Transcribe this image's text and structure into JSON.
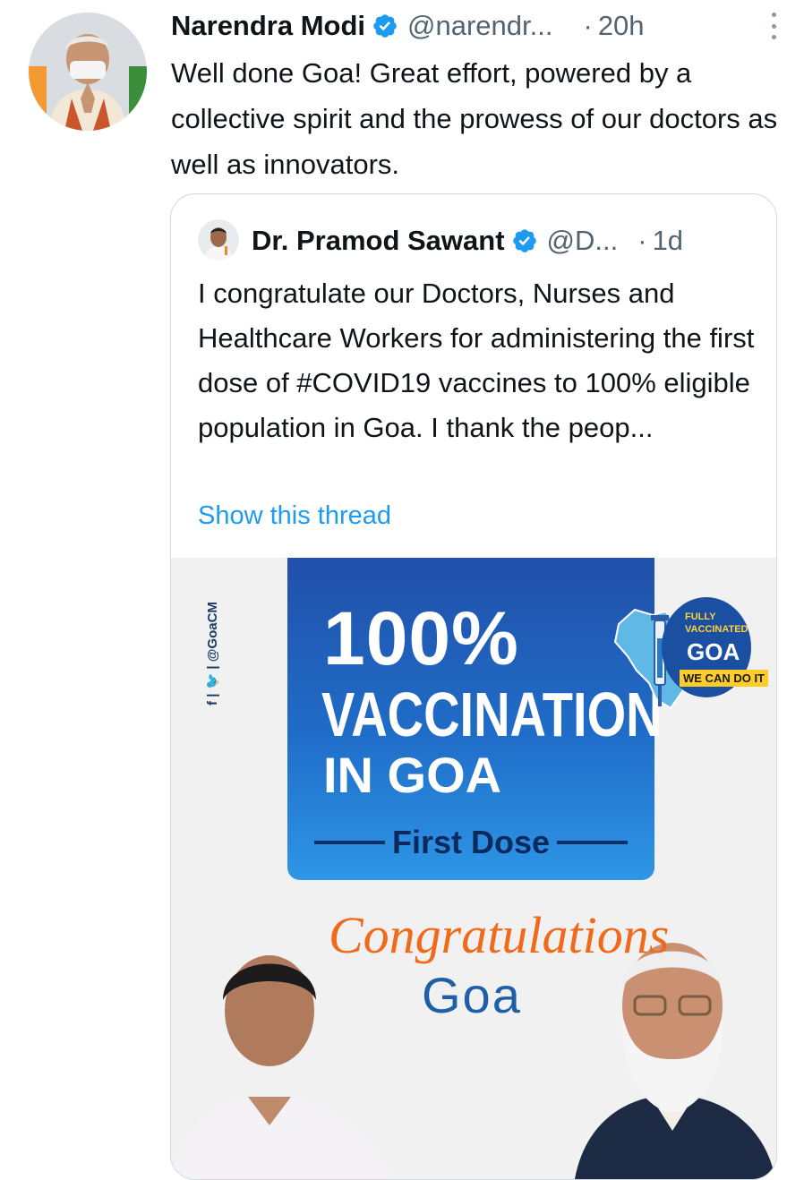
{
  "tweet": {
    "author_name": "Narendra Modi",
    "handle": "@narendr...",
    "separator": "·",
    "time": "20h",
    "text": "Well done Goa! Great effort, powered by a collective spirit and the prowess of our doctors as well as innovators."
  },
  "quoted": {
    "author_name": "Dr. Pramod Sawant",
    "handle": "@D...",
    "separator": "·",
    "time": "1d",
    "text": "I congratulate our Doctors, Nurses and Healthcare Workers for administering the first dose of #COVID19 vaccines to 100% eligible population in Goa. I thank the peop...",
    "show_thread": "Show this thread"
  },
  "media": {
    "social_handle": "f | 🐦 | @GoaCM",
    "headline_pct": "100%",
    "headline_line2": "VACCINATION",
    "headline_line3": "IN GOA",
    "sub_label": "First Dose",
    "badge_line1": "FULLY",
    "badge_line2": "VACCINATED",
    "badge_line3": "GOA",
    "badge_tag": "WE CAN DO IT",
    "congrats": "Congratulations",
    "goa": "Goa"
  },
  "colors": {
    "verified": "#1d9bf0",
    "link": "#1d9bf0",
    "muted": "#536471"
  }
}
